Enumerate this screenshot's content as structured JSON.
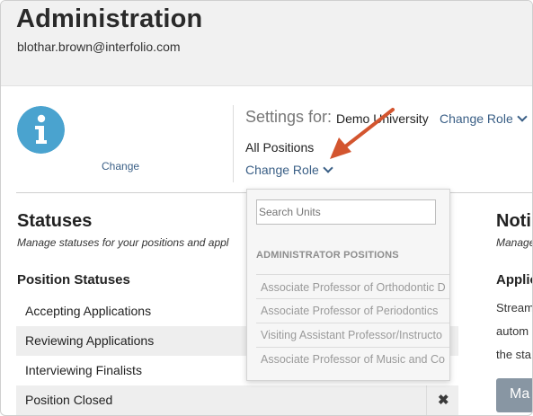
{
  "header": {
    "title": "Administration",
    "email": "blothar.brown@interfolio.com"
  },
  "profile": {
    "icon": "info-icon",
    "change_label": "Change"
  },
  "settings": {
    "label": "Settings for:",
    "organization": "Demo University",
    "change_role_label": "Change Role",
    "all_positions": "All Positions",
    "change_role_label_2": "Change Role"
  },
  "statuses": {
    "title": "Statuses",
    "description": "Manage statuses for your positions and appl",
    "section_title": "Position Statuses",
    "rows": [
      "Accepting Applications",
      "Reviewing Applications",
      "Interviewing Finalists",
      "Position Closed"
    ],
    "delete_glyph": "✖"
  },
  "notifications": {
    "title": "Noti",
    "description": "Manage",
    "section_title": "Applic",
    "lines": [
      "Stream",
      "autom",
      "the sta"
    ],
    "manage_button": "Ma"
  },
  "dropdown": {
    "search_placeholder": "Search Units",
    "header": "ADMINISTRATOR POSITIONS",
    "items": [
      "Associate Professor of Orthodontic D",
      "Associate Professor of Periodontics",
      "Visiting Assistant Professor/Instructo",
      "Associate Professor of Music and Co"
    ]
  },
  "colors": {
    "link": "#3a5f86",
    "info_icon": "#4aa3cf",
    "arrow": "#d3552f",
    "manage_button": "#8896a3"
  }
}
